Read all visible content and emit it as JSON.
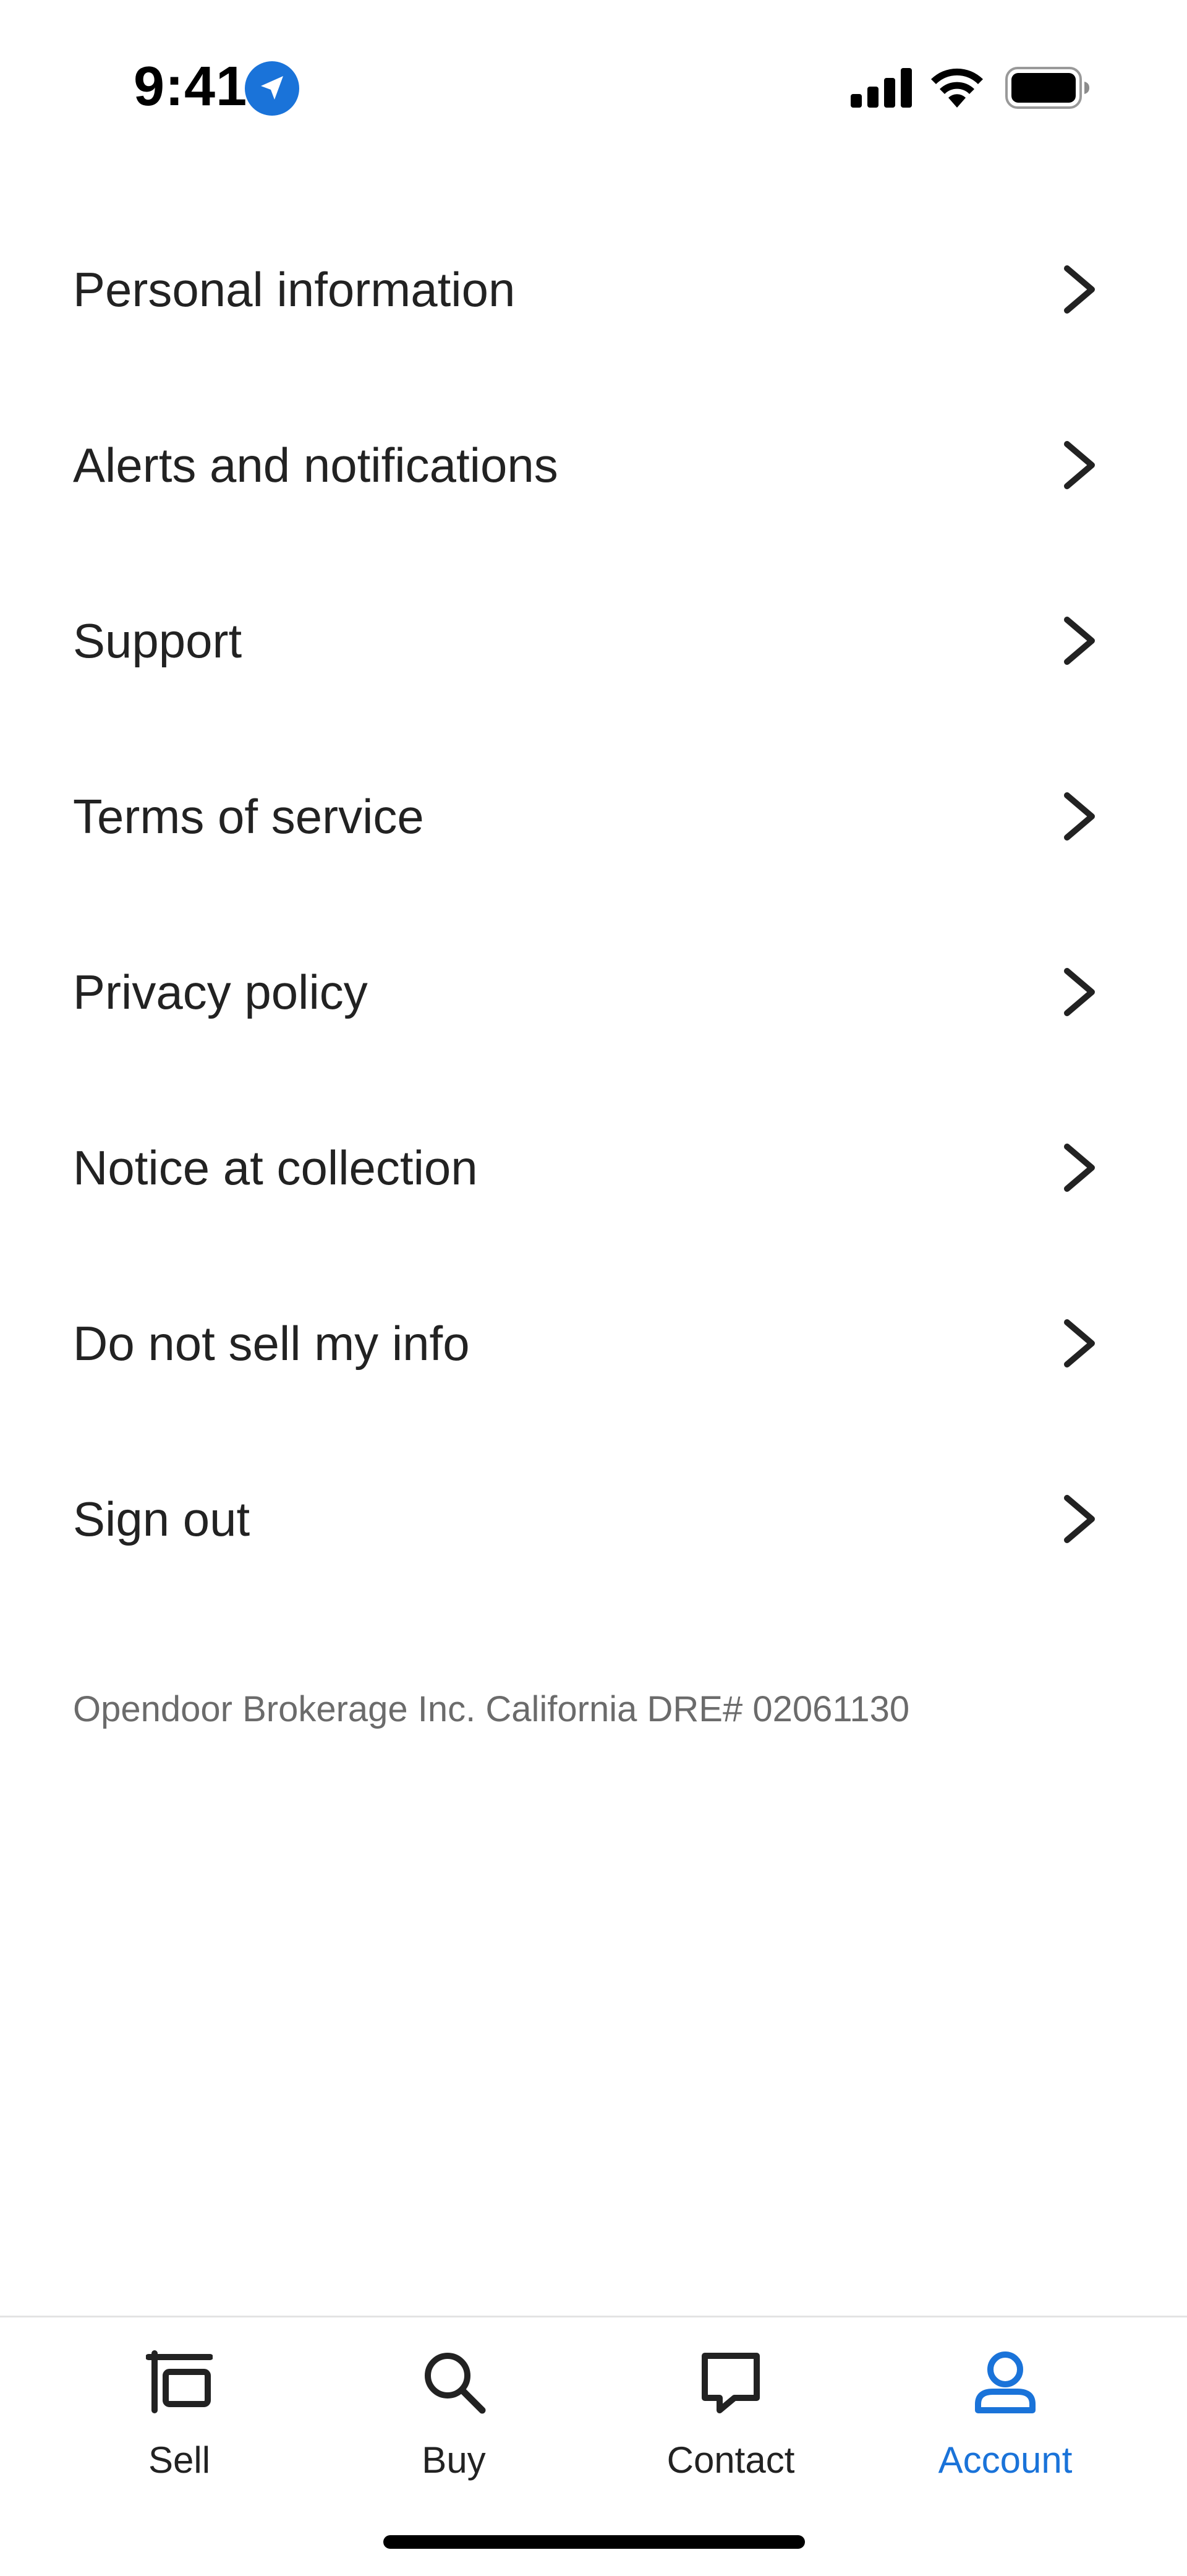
{
  "status_bar": {
    "time": "9:41",
    "location_icon": "location-arrow-icon",
    "signal_icon": "cellular-signal-icon",
    "wifi_icon": "wifi-icon",
    "battery_icon": "battery-icon",
    "location_badge_color": "#1a73d9"
  },
  "menu": {
    "items": [
      {
        "label": "Personal information",
        "icon": "chevron-right-icon"
      },
      {
        "label": "Alerts and notifications",
        "icon": "chevron-right-icon"
      },
      {
        "label": "Support",
        "icon": "chevron-right-icon"
      },
      {
        "label": "Terms of service",
        "icon": "chevron-right-icon"
      },
      {
        "label": "Privacy policy",
        "icon": "chevron-right-icon"
      },
      {
        "label": "Notice at collection",
        "icon": "chevron-right-icon"
      },
      {
        "label": "Do not sell my info",
        "icon": "chevron-right-icon"
      },
      {
        "label": "Sign out",
        "icon": "chevron-right-icon"
      }
    ]
  },
  "legal": {
    "text": "Opendoor Brokerage Inc. California DRE# 02061130"
  },
  "tab_bar": {
    "active_color": "#1a73d9",
    "inactive_color": "#222222",
    "tabs": [
      {
        "label": "Sell",
        "icon": "sell-sign-icon",
        "active": false
      },
      {
        "label": "Buy",
        "icon": "search-icon",
        "active": false
      },
      {
        "label": "Contact",
        "icon": "chat-bubble-icon",
        "active": false
      },
      {
        "label": "Account",
        "icon": "person-icon",
        "active": true
      }
    ]
  }
}
